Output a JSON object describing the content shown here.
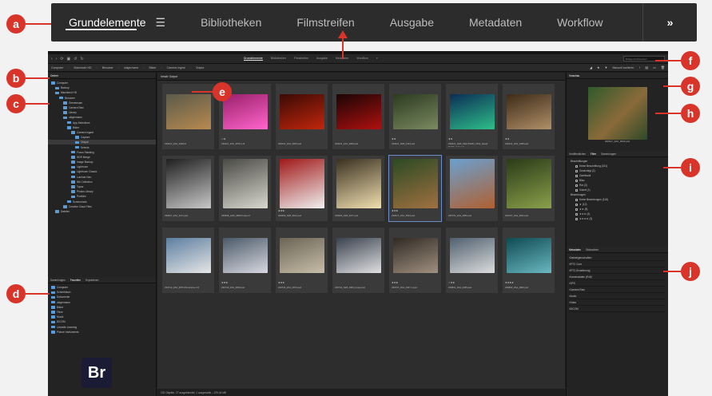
{
  "zoom_bar": {
    "tabs": [
      "Grundelemente",
      "Bibliotheken",
      "Filmstreifen",
      "Ausgabe",
      "Metadaten",
      "Workflow"
    ],
    "active_index": 0,
    "more_label": "»"
  },
  "callouts": [
    "a",
    "b",
    "c",
    "d",
    "e",
    "f",
    "g",
    "h",
    "i",
    "j"
  ],
  "toolbar": {
    "tabs": [
      "Grundelemente",
      "Bibliotheken",
      "Filmstreifen",
      "Ausgabe",
      "Metadaten",
      "Workflow"
    ],
    "search_placeholder": "Bridge durchsuchen"
  },
  "path": {
    "crumbs": [
      "Computer",
      "Macintosh HD",
      "Benutzer",
      "uldgermann",
      "Bilder",
      "Camera Ingest",
      "Output"
    ],
    "sort_label": "Manuell sortieren"
  },
  "left": {
    "folders_tab": "Ordner",
    "tree": [
      "Computer",
      "Backup",
      "Macintosh HD",
      "Benutzer",
      "Gemeinsam",
      "Camera Raw",
      "Library",
      "uldgermann",
      "App-Selections",
      "Bilder",
      "Camera Ingest",
      "Capture",
      "Output",
      "Selects",
      "Focus Stacking",
      "HDR Merge",
      "Image Backup",
      "Lightroom",
      "Lightroom Classic",
      "Luminar Neo",
      "Nik Collection",
      "Topaz",
      "Photos Library",
      "Portfolio",
      "Screenshots",
      "Creative Cloud Files",
      "Dateien"
    ],
    "selected_index": 12,
    "favorites_tabs": [
      "Sammlungen",
      "Favoriten",
      "Exportieren"
    ],
    "favorites": [
      "Computer",
      "Schreibtisch",
      "Dokumente",
      "uldgermann",
      "Bilder",
      "Filme",
      "Musik",
      "DICOM",
      "Linkedin Learning",
      "Picture Instruments"
    ],
    "logo": "Br"
  },
  "content": {
    "tab_label": "Inhalt: Output",
    "rows": [
      [
        {
          "cap": "230221_ZA2_2448.tif",
          "stars": "",
          "c1": "#5b5a4a",
          "c2": "#b88a50"
        },
        {
          "cap": "230221_ZA2_2578-1.tif",
          "stars": "☆★",
          "c1": "#9a1f6a",
          "c2": "#ff66cc"
        },
        {
          "cap": "230221_ZA2_2605.psd",
          "stars": "",
          "c1": "#3a0a05",
          "c2": "#c2260d"
        },
        {
          "cap": "230221_ZA2_2606.psd",
          "stars": "",
          "c1": "#1a0505",
          "c2": "#b01010"
        },
        {
          "cap": "230221_N28_0443.psd",
          "stars": "★★",
          "c1": "#2c3a20",
          "c2": "#7a8a60"
        },
        {
          "cap": "230221_N28_NIGHTGRD_7062_Deepf RAKE_web.psd",
          "stars": "★★",
          "c1": "#0b2d55",
          "c2": "#2ebf8a"
        },
        {
          "cap": "230221_ZA2_2468.psd",
          "stars": "★★",
          "c1": "#3d2a18",
          "c2": "#b09068"
        }
      ],
      [
        {
          "cap": "230607_ZA2_3471.psd",
          "stars": "",
          "c1": "#202020",
          "c2": "#c8c8c8"
        },
        {
          "cap": "230608_LMG_9809 Kopie.tif",
          "stars": "",
          "c1": "#4a4a44",
          "c2": "#d8d8d0"
        },
        {
          "cap": "230609_N28_9914.psd",
          "stars": "★★★",
          "c1": "#a01818",
          "c2": "#f0f0f0"
        },
        {
          "cap": "230609_N28_9477.psd",
          "stars": "",
          "c1": "#3a3020",
          "c2": "#f0e0b0"
        },
        {
          "cap": "230617_ZA2_3533.psd",
          "stars": "★★★",
          "c1": "#2c4a24",
          "c2": "#a07040"
        },
        {
          "cap": "230701_ZA2_3656.psd",
          "stars": "",
          "c1": "#6aa0d0",
          "c2": "#b06030"
        },
        {
          "cap": "230707_ZA2_3631.psd",
          "stars": "",
          "c1": "#2a3a18",
          "c2": "#8aa04a"
        }
      ],
      [
        {
          "cap": "230712_ZA2_3676-Panorama-1.tif",
          "stars": "",
          "c1": "#5c7ea0",
          "c2": "#e6e6e6"
        },
        {
          "cap": "230719_ZA2_3819.psd",
          "stars": "★★★",
          "c1": "#4a5a68",
          "c2": "#d8d8e0"
        },
        {
          "cap": "230730_ZA2_4154.psd",
          "stars": "★★★",
          "c1": "#6a6456",
          "c2": "#c8bea8"
        },
        {
          "cap": "230731_N28_4400_Kopie.psd",
          "stars": "",
          "c1": "#3a4250",
          "c2": "#e0e0e0"
        },
        {
          "cap": "230737_ZA2_4427-1.psd",
          "stars": "★★★",
          "c1": "#302a24",
          "c2": "#a09080"
        },
        {
          "cap": "230801_ZA2_4455.psd",
          "stars": "☆★★",
          "c1": "#506070",
          "c2": "#dcdcdc"
        },
        {
          "cap": "230803_ZA2_4500.psd",
          "stars": "★★★★",
          "c1": "#0f4a52",
          "c2": "#6ab8c0"
        }
      ]
    ]
  },
  "right": {
    "preview_tab": "Vorschau",
    "preview_caption": "230617_ZA2_3533.psd",
    "filter_tabs": [
      "Veröffentlichen",
      "Filter",
      "Sammlungen"
    ],
    "filter_rows": [
      "Beschriftungen",
      "Keine Beschriftung (151)",
      "Gewichtigt (2)",
      "Zweitwahl",
      "Blau",
      "Rot (3)",
      "Violett (1)",
      "Bewertungen",
      "Keine Bewertungen (118)",
      "★ (12)",
      "★★ (8)",
      "★★★ (4)",
      "★★★★ (3)"
    ],
    "meta_tabs": [
      "Metadaten",
      "Stichwörter"
    ],
    "meta_rows": [
      "Dateieigenschaften",
      "IPTC Core",
      "IPTC-Erweiterung",
      "Kameradaten (Exif)",
      "GPS",
      "Camera Raw",
      "Audio",
      "Video",
      "DICOM"
    ]
  },
  "status": "232 Objekte, 27 ausgeblendet, 1 ausgewählt – 229,44 MB"
}
